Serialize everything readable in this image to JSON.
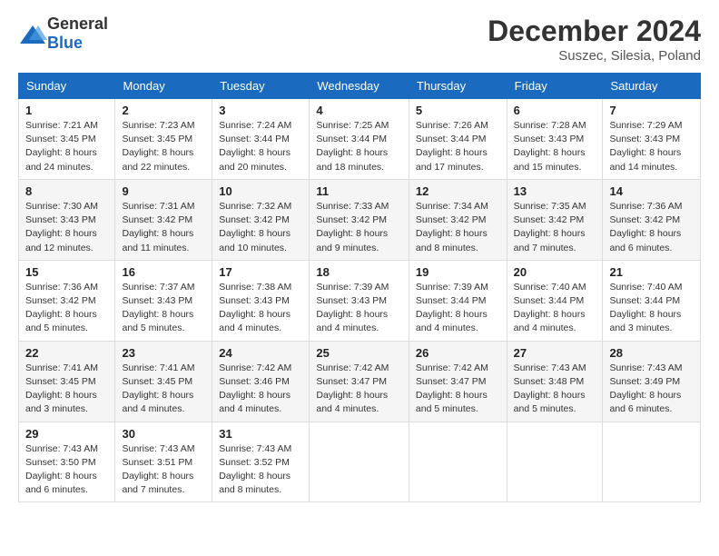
{
  "header": {
    "logo_general": "General",
    "logo_blue": "Blue",
    "month_title": "December 2024",
    "location": "Suszec, Silesia, Poland"
  },
  "columns": [
    "Sunday",
    "Monday",
    "Tuesday",
    "Wednesday",
    "Thursday",
    "Friday",
    "Saturday"
  ],
  "weeks": [
    [
      {
        "day": "1",
        "sunrise": "7:21 AM",
        "sunset": "3:45 PM",
        "daylight": "8 hours and 24 minutes."
      },
      {
        "day": "2",
        "sunrise": "7:23 AM",
        "sunset": "3:45 PM",
        "daylight": "8 hours and 22 minutes."
      },
      {
        "day": "3",
        "sunrise": "7:24 AM",
        "sunset": "3:44 PM",
        "daylight": "8 hours and 20 minutes."
      },
      {
        "day": "4",
        "sunrise": "7:25 AM",
        "sunset": "3:44 PM",
        "daylight": "8 hours and 18 minutes."
      },
      {
        "day": "5",
        "sunrise": "7:26 AM",
        "sunset": "3:44 PM",
        "daylight": "8 hours and 17 minutes."
      },
      {
        "day": "6",
        "sunrise": "7:28 AM",
        "sunset": "3:43 PM",
        "daylight": "8 hours and 15 minutes."
      },
      {
        "day": "7",
        "sunrise": "7:29 AM",
        "sunset": "3:43 PM",
        "daylight": "8 hours and 14 minutes."
      }
    ],
    [
      {
        "day": "8",
        "sunrise": "7:30 AM",
        "sunset": "3:43 PM",
        "daylight": "8 hours and 12 minutes."
      },
      {
        "day": "9",
        "sunrise": "7:31 AM",
        "sunset": "3:42 PM",
        "daylight": "8 hours and 11 minutes."
      },
      {
        "day": "10",
        "sunrise": "7:32 AM",
        "sunset": "3:42 PM",
        "daylight": "8 hours and 10 minutes."
      },
      {
        "day": "11",
        "sunrise": "7:33 AM",
        "sunset": "3:42 PM",
        "daylight": "8 hours and 9 minutes."
      },
      {
        "day": "12",
        "sunrise": "7:34 AM",
        "sunset": "3:42 PM",
        "daylight": "8 hours and 8 minutes."
      },
      {
        "day": "13",
        "sunrise": "7:35 AM",
        "sunset": "3:42 PM",
        "daylight": "8 hours and 7 minutes."
      },
      {
        "day": "14",
        "sunrise": "7:36 AM",
        "sunset": "3:42 PM",
        "daylight": "8 hours and 6 minutes."
      }
    ],
    [
      {
        "day": "15",
        "sunrise": "7:36 AM",
        "sunset": "3:42 PM",
        "daylight": "8 hours and 5 minutes."
      },
      {
        "day": "16",
        "sunrise": "7:37 AM",
        "sunset": "3:43 PM",
        "daylight": "8 hours and 5 minutes."
      },
      {
        "day": "17",
        "sunrise": "7:38 AM",
        "sunset": "3:43 PM",
        "daylight": "8 hours and 4 minutes."
      },
      {
        "day": "18",
        "sunrise": "7:39 AM",
        "sunset": "3:43 PM",
        "daylight": "8 hours and 4 minutes."
      },
      {
        "day": "19",
        "sunrise": "7:39 AM",
        "sunset": "3:44 PM",
        "daylight": "8 hours and 4 minutes."
      },
      {
        "day": "20",
        "sunrise": "7:40 AM",
        "sunset": "3:44 PM",
        "daylight": "8 hours and 4 minutes."
      },
      {
        "day": "21",
        "sunrise": "7:40 AM",
        "sunset": "3:44 PM",
        "daylight": "8 hours and 3 minutes."
      }
    ],
    [
      {
        "day": "22",
        "sunrise": "7:41 AM",
        "sunset": "3:45 PM",
        "daylight": "8 hours and 3 minutes."
      },
      {
        "day": "23",
        "sunrise": "7:41 AM",
        "sunset": "3:45 PM",
        "daylight": "8 hours and 4 minutes."
      },
      {
        "day": "24",
        "sunrise": "7:42 AM",
        "sunset": "3:46 PM",
        "daylight": "8 hours and 4 minutes."
      },
      {
        "day": "25",
        "sunrise": "7:42 AM",
        "sunset": "3:47 PM",
        "daylight": "8 hours and 4 minutes."
      },
      {
        "day": "26",
        "sunrise": "7:42 AM",
        "sunset": "3:47 PM",
        "daylight": "8 hours and 5 minutes."
      },
      {
        "day": "27",
        "sunrise": "7:43 AM",
        "sunset": "3:48 PM",
        "daylight": "8 hours and 5 minutes."
      },
      {
        "day": "28",
        "sunrise": "7:43 AM",
        "sunset": "3:49 PM",
        "daylight": "8 hours and 6 minutes."
      }
    ],
    [
      {
        "day": "29",
        "sunrise": "7:43 AM",
        "sunset": "3:50 PM",
        "daylight": "8 hours and 6 minutes."
      },
      {
        "day": "30",
        "sunrise": "7:43 AM",
        "sunset": "3:51 PM",
        "daylight": "8 hours and 7 minutes."
      },
      {
        "day": "31",
        "sunrise": "7:43 AM",
        "sunset": "3:52 PM",
        "daylight": "8 hours and 8 minutes."
      },
      null,
      null,
      null,
      null
    ]
  ],
  "labels": {
    "sunrise": "Sunrise:",
    "sunset": "Sunset:",
    "daylight": "Daylight:"
  }
}
